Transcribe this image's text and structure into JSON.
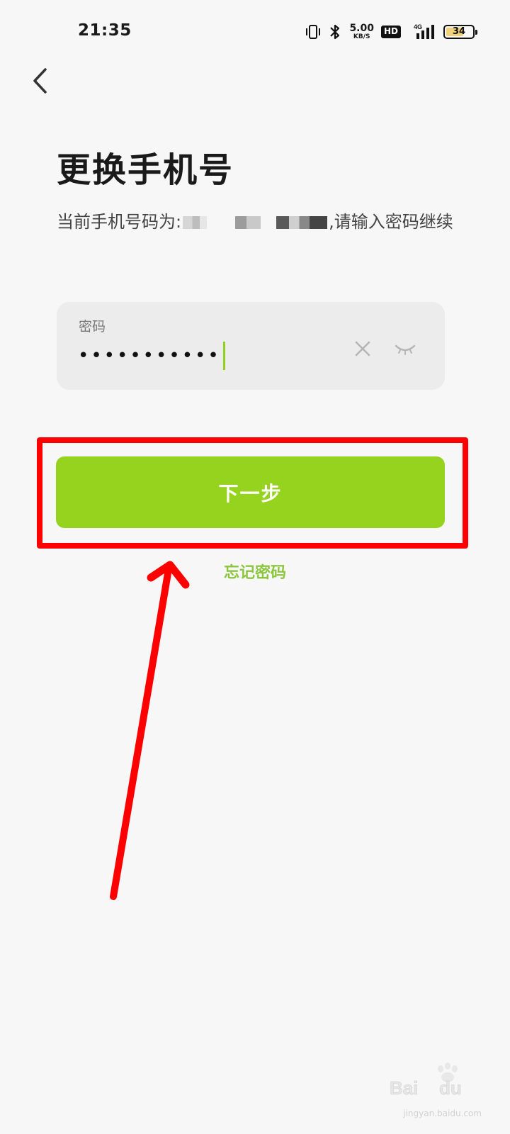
{
  "status_bar": {
    "time": "21:35",
    "network_speed_value": "5.00",
    "network_speed_unit": "KB/S",
    "hd_label": "HD",
    "network_type": "4G",
    "battery_level": "34",
    "icons": [
      "vibrate-icon",
      "bluetooth-icon",
      "hd-icon",
      "signal-icon",
      "battery-icon"
    ]
  },
  "header": {
    "back_icon": "chevron-left-icon",
    "title": "更换手机号"
  },
  "description": {
    "prefix": "当前手机号码为:",
    "suffix": ",请输入密码继续"
  },
  "password_field": {
    "label": "密码",
    "value": "•••••••••••",
    "clear_icon": "close-icon",
    "visibility_icon": "eye-closed-icon"
  },
  "actions": {
    "next_label": "下一步",
    "forgot_password_label": "忘记密码"
  },
  "annotation": {
    "highlight_color": "#ff0000"
  },
  "watermark": {
    "url": "jingyan.baidu.com"
  },
  "colors": {
    "accent": "#95d31f",
    "link": "#8cc63f",
    "background": "#f7f7f7",
    "card": "#ececec"
  }
}
